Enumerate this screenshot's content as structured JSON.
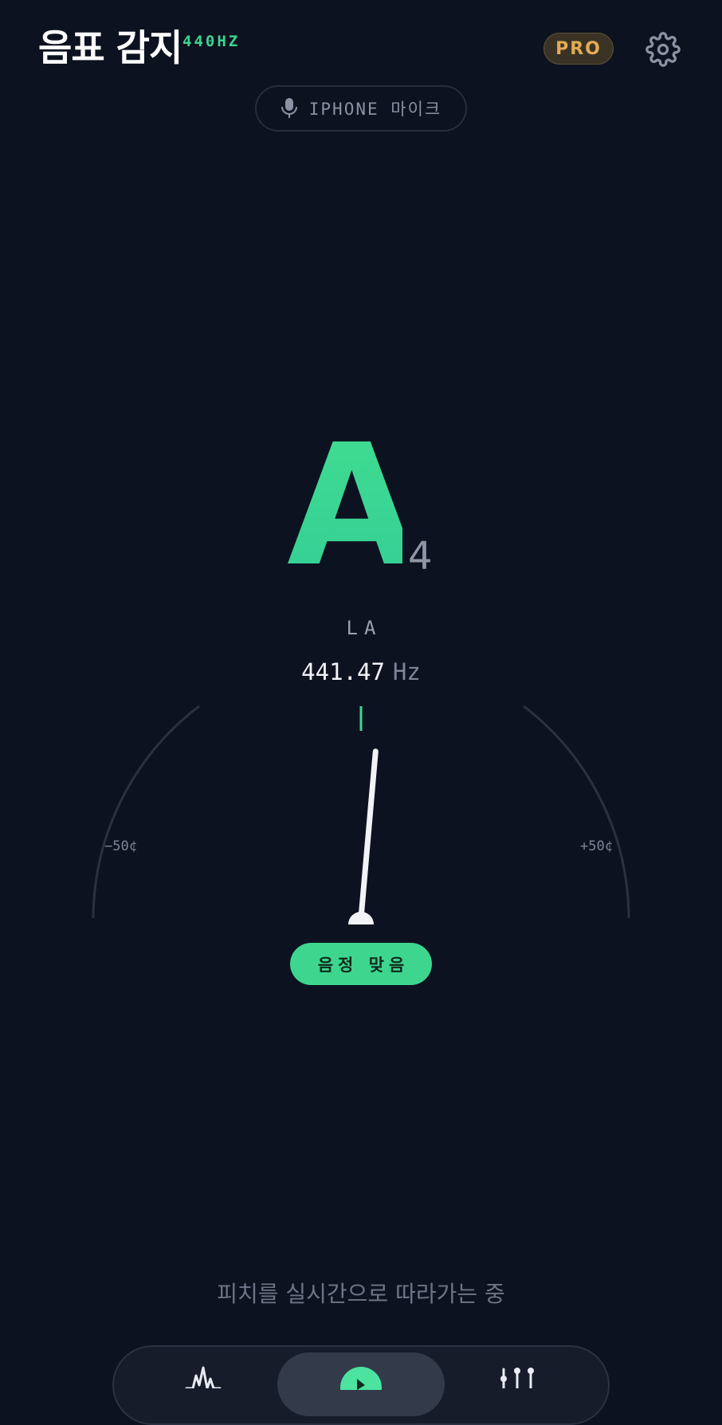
{
  "header": {
    "title": "음표 감지",
    "reference_pitch": "440HZ",
    "pro_label": "PRO",
    "settings_icon": "gear-icon"
  },
  "input_source": {
    "icon": "microphone-icon",
    "label": "IPHONE 마이크"
  },
  "detected": {
    "note": "A",
    "octave": "4",
    "solfege": "LA",
    "frequency": "441.47",
    "frequency_unit": "Hz",
    "cents_deviation": 5
  },
  "gauge": {
    "min_label": "−50¢",
    "max_label": "+50¢",
    "range_cents": [
      -50,
      50
    ]
  },
  "status": {
    "label": "음정 맞음"
  },
  "caption": "피치를 실시간으로 따라가는 중",
  "tabbar": {
    "tabs": [
      {
        "name": "waveform-icon",
        "active": false
      },
      {
        "name": "tuner-icon",
        "active": true
      },
      {
        "name": "mixer-icon",
        "active": false
      }
    ]
  },
  "colors": {
    "background": "#0d1220",
    "accent_green": "#3ed68f",
    "pro_gold": "#e3ab55",
    "muted_text": "#7d8597"
  }
}
